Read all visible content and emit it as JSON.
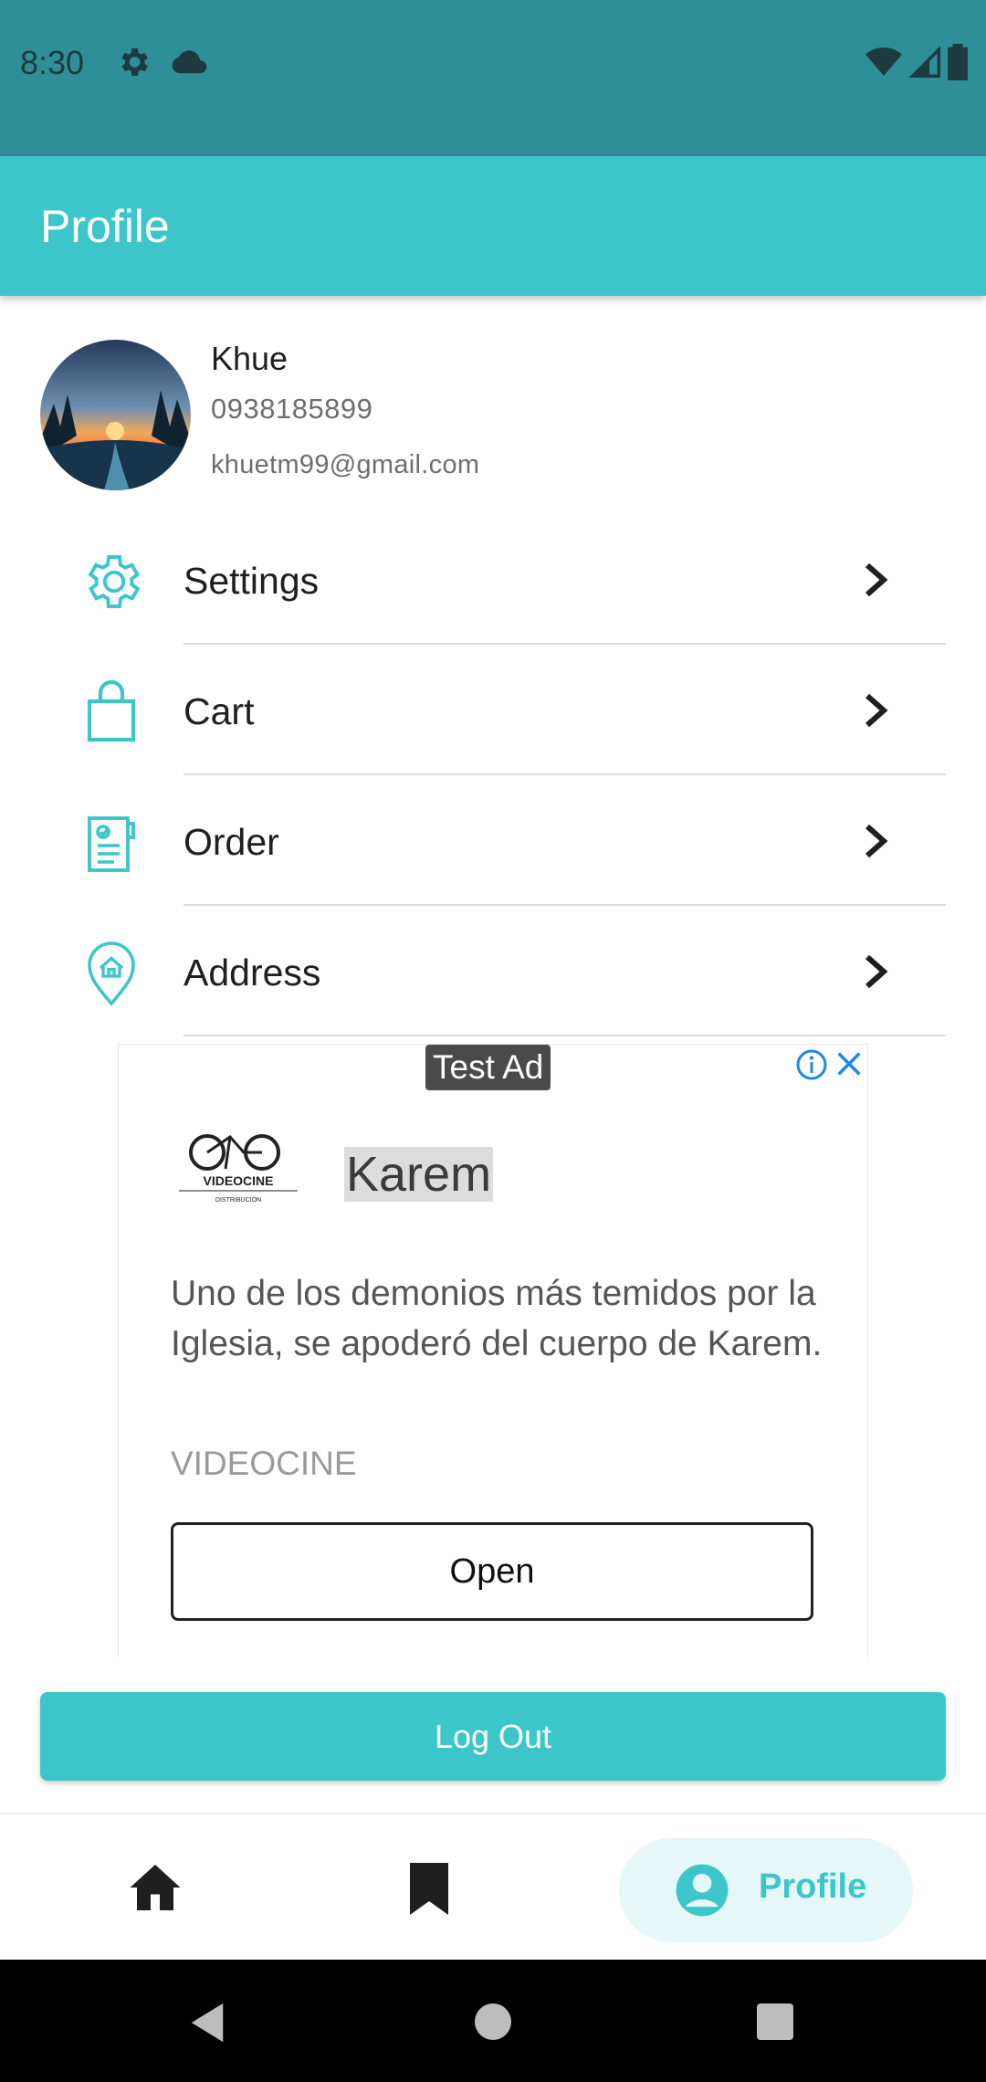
{
  "status_bar": {
    "time": "8:30",
    "icons": [
      "gear-icon",
      "cloud-icon",
      "wifi-icon",
      "signal-icon",
      "battery-icon"
    ],
    "color": "#2E8F99"
  },
  "app_bar": {
    "title": "Profile",
    "color": "#3CC6C9"
  },
  "user": {
    "name": "Khue",
    "phone": "0938185899",
    "email": "khuetm99@gmail.com"
  },
  "menu": {
    "items": [
      {
        "label": "Settings",
        "icon": "gear-icon"
      },
      {
        "label": "Cart",
        "icon": "shopping-bag-icon"
      },
      {
        "label": "Order",
        "icon": "order-list-icon"
      },
      {
        "label": "Address",
        "icon": "location-home-icon"
      }
    ]
  },
  "ad": {
    "badge": "Test Ad",
    "logo_text": "VIDEOCINE",
    "logo_subtext": "DISTRIBUCIÓN",
    "headline": "Karem",
    "body": "Uno de los demonios más temidos por la Iglesia, se apoderó del cuerpo de Karem.",
    "advertiser": "VIDEOCINE",
    "cta": "Open"
  },
  "logout_label": "Log Out",
  "bottom_nav": {
    "items": [
      {
        "icon": "home-icon",
        "label": ""
      },
      {
        "icon": "bookmark-icon",
        "label": ""
      },
      {
        "icon": "profile-icon",
        "label": "Profile",
        "active": true
      }
    ],
    "accent": "#3CC6C9"
  }
}
